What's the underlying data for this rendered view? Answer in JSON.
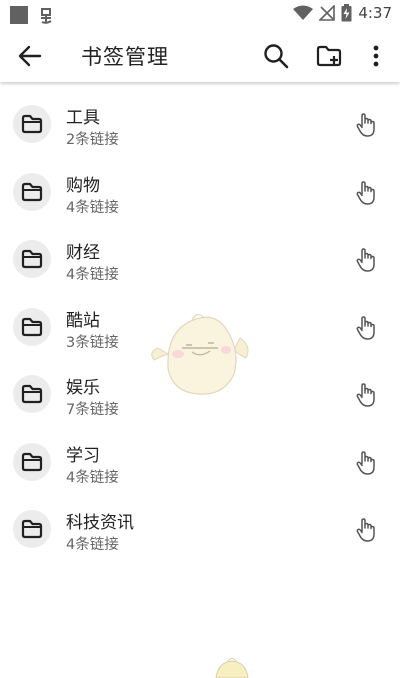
{
  "status_bar": {
    "time": "4:37"
  },
  "app_bar": {
    "title": "书签管理"
  },
  "folders": [
    {
      "name": "工具",
      "count": "2条链接"
    },
    {
      "name": "购物",
      "count": "4条链接"
    },
    {
      "name": "财经",
      "count": "4条链接"
    },
    {
      "name": "酷站",
      "count": "3条链接"
    },
    {
      "name": "娱乐",
      "count": "7条链接"
    },
    {
      "name": "学习",
      "count": "4条链接"
    },
    {
      "name": "科技资讯",
      "count": "4条链接"
    }
  ],
  "icons": {
    "back": "arrow-left-icon",
    "search": "search-icon",
    "new_folder": "folder-plus-icon",
    "more": "more-vert-icon",
    "folder": "folder-icon",
    "drag": "hand-pointer-icon"
  },
  "colors": {
    "text_primary": "#212121",
    "text_secondary": "#666666",
    "icon_bg": "#ececec"
  }
}
